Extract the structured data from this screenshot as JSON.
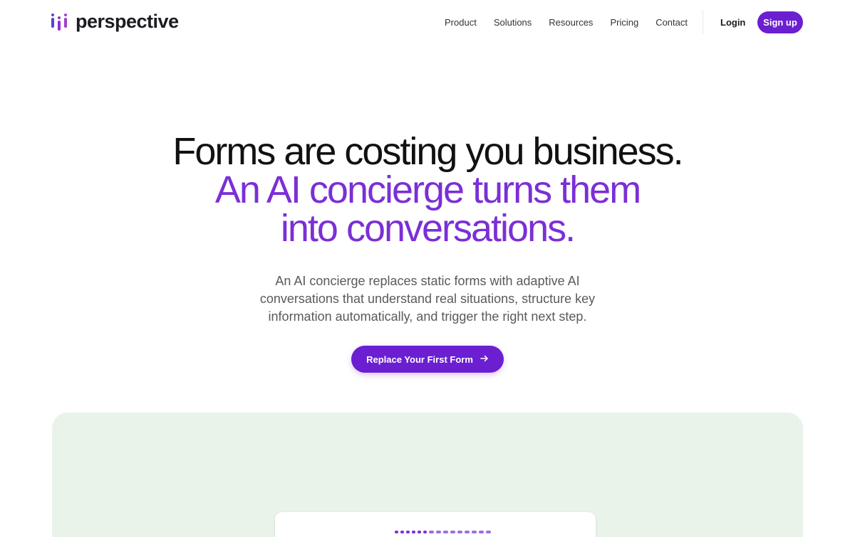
{
  "brand": {
    "name": "perspective",
    "accent": "#6b1fd1",
    "highlight": "#7b2fd6",
    "logo_icon": "equalizer-bars-icon"
  },
  "nav": {
    "items": [
      "Product",
      "Solutions",
      "Resources",
      "Pricing",
      "Contact"
    ],
    "login_label": "Login",
    "signup_label": "Sign up"
  },
  "hero": {
    "title_line1": "Forms are costing you business.",
    "title_line2": "An AI concierge turns them into conversations.",
    "subtitle": "An AI concierge replaces static forms with adaptive AI conversations that understand real situations, structure key information automatically, and trigger the right next step.",
    "cta_label": "Replace Your First Form",
    "cta_icon": "arrow-right-icon"
  },
  "demo": {
    "panel_color": "#e9f3ea",
    "progress_steps_total": 15,
    "progress_steps_done": 6
  }
}
